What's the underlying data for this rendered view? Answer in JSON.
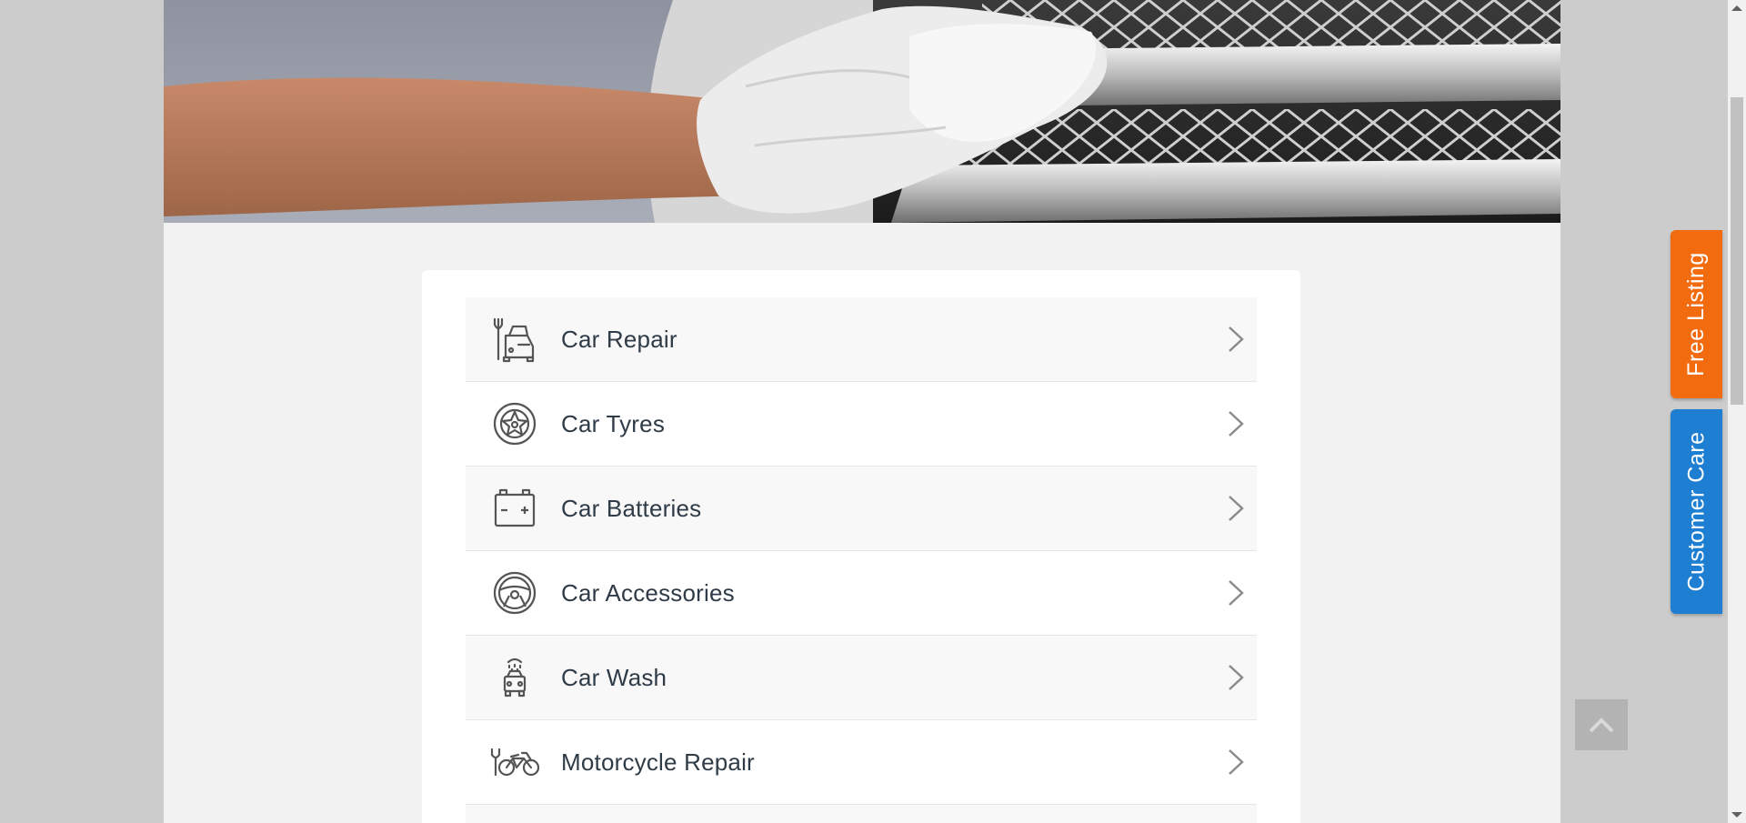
{
  "categories": [
    {
      "label": "Car Repair",
      "icon": "car-repair-icon"
    },
    {
      "label": "Car Tyres",
      "icon": "tyre-icon"
    },
    {
      "label": "Car Batteries",
      "icon": "battery-icon"
    },
    {
      "label": "Car Accessories",
      "icon": "steering-wheel-icon"
    },
    {
      "label": "Car Wash",
      "icon": "car-wash-icon"
    },
    {
      "label": "Motorcycle Repair",
      "icon": "motorcycle-repair-icon"
    }
  ],
  "side_tabs": {
    "free_listing": "Free Listing",
    "customer_care": "Customer Care"
  },
  "colors": {
    "free_listing": "#f26b0f",
    "customer_care": "#1e7fd2",
    "icon_stroke": "#555555",
    "label_text": "#2f3b47"
  }
}
